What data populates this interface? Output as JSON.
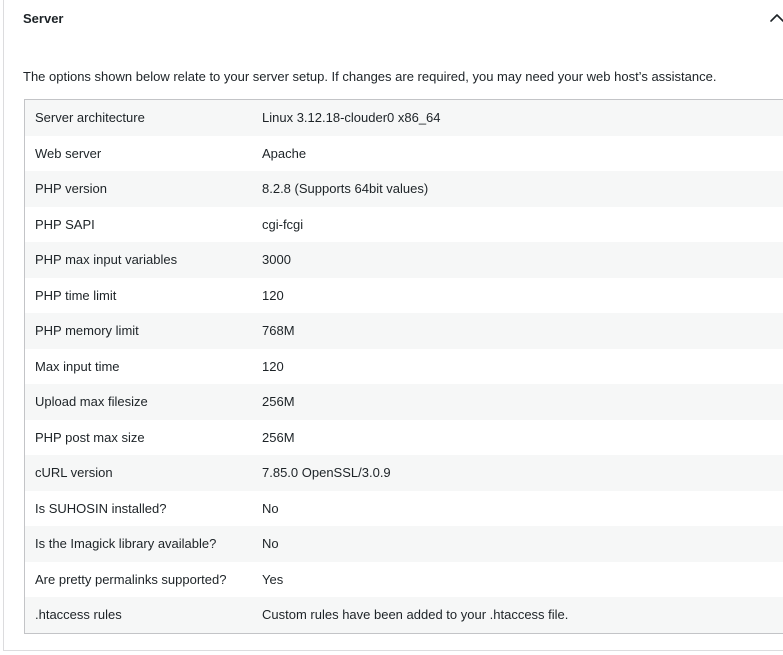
{
  "section": {
    "title": "Server",
    "expanded": true,
    "description": "The options shown below relate to your server setup. If changes are required, you may need your web host’s assistance."
  },
  "rows": [
    {
      "label": "Server architecture",
      "value": "Linux 3.12.18-clouder0 x86_64"
    },
    {
      "label": "Web server",
      "value": "Apache"
    },
    {
      "label": "PHP version",
      "value": "8.2.8 (Supports 64bit values)"
    },
    {
      "label": "PHP SAPI",
      "value": "cgi-fcgi"
    },
    {
      "label": "PHP max input variables",
      "value": "3000"
    },
    {
      "label": "PHP time limit",
      "value": "120"
    },
    {
      "label": "PHP memory limit",
      "value": "768M"
    },
    {
      "label": "Max input time",
      "value": "120"
    },
    {
      "label": "Upload max filesize",
      "value": "256M"
    },
    {
      "label": "PHP post max size",
      "value": "256M"
    },
    {
      "label": "cURL version",
      "value": "7.85.0 OpenSSL/3.0.9"
    },
    {
      "label": "Is SUHOSIN installed?",
      "value": "No"
    },
    {
      "label": "Is the Imagick library available?",
      "value": "No"
    },
    {
      "label": "Are pretty permalinks supported?",
      "value": "Yes"
    },
    {
      "label": ".htaccess rules",
      "value": "Custom rules have been added to your .htaccess file."
    }
  ],
  "icons": {
    "toggle": "chevron-up-icon"
  },
  "colors": {
    "text": "#1d2327",
    "row_alt": "#f6f7f7",
    "border": "#c3c4c7"
  }
}
